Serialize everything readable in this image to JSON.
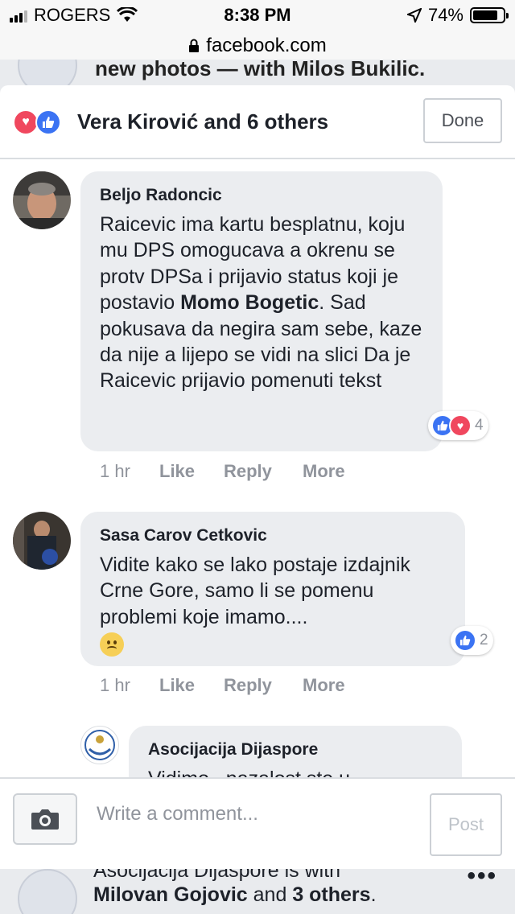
{
  "status_bar": {
    "carrier": "ROGERS",
    "time": "8:38 PM",
    "battery": "74%",
    "battery_level": 0.74
  },
  "browser": {
    "url": "facebook.com"
  },
  "background_feed": {
    "top_text": "new photos — with Milos Bukilic.",
    "bottom_line1": "Asocijacija Dijaspore is with",
    "bottom_line2_name": "Milovan Gojovic",
    "bottom_line2_mid": " and ",
    "bottom_line2_others": "3 others",
    "bottom_line2_end": ".",
    "more_dots": "•••"
  },
  "reactions_header": {
    "title": "Vera Kirović and 6 others",
    "done_label": "Done",
    "icons": [
      "love-icon",
      "like-icon"
    ]
  },
  "comments": [
    {
      "author": "Beljo Radoncic",
      "text_part1": "Raicevic ima kartu besplatnu, koju mu DPS omogucava a okrenu se protv DPSa i prijavio status koji je postavio ",
      "text_bold": "Momo Bogetic",
      "text_part2": ". Sad pokusava da negira sam sebe, kaze da nije a lijepo se vidi na slici Da je Raicevic prijavio pomenuti tekst",
      "time": "1 hr",
      "like_label": "Like",
      "reply_label": "Reply",
      "more_label": "More",
      "reaction_count": "4",
      "reaction_icons": [
        "like-icon",
        "love-icon"
      ]
    },
    {
      "author": "Sasa Carov Cetkovic",
      "text_part1": "Vidite kako se lako postaje izdajnik Crne Gore, samo li se pomenu problemi koje imamo....",
      "emoji": "worried-face-icon",
      "time": "1 hr",
      "like_label": "Like",
      "reply_label": "Reply",
      "more_label": "More",
      "reaction_count": "2",
      "reaction_icons": [
        "like-icon"
      ]
    },
    {
      "author": "Asocijacija Dijaspore",
      "text_partial": "Vidimo , nazalost ste u"
    }
  ],
  "composer": {
    "placeholder": "Write a comment...",
    "post_label": "Post"
  },
  "colors": {
    "like_blue": "#3b73f3",
    "love_red": "#f0475e",
    "bubble_gray": "#ebedf0",
    "meta_gray": "#90949c"
  }
}
